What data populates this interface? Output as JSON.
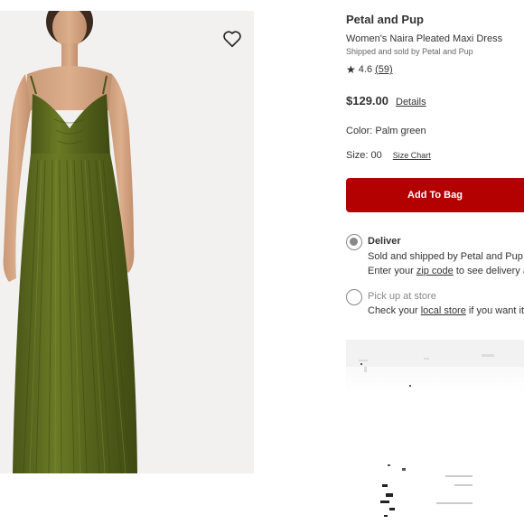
{
  "product": {
    "brand": "Petal and Pup",
    "name": "Women's Naira Pleated Maxi Dress",
    "shipped_by": "Shipped and sold by Petal and Pup",
    "rating": "4.6",
    "review_count": "(59)",
    "price": "$129.00",
    "price_details_link": "Details",
    "color": "Color: Palm green",
    "size": "Size: 00",
    "size_chart_link": "Size Chart",
    "add_to_bag_label": "Add To Bag"
  },
  "fulfillment": {
    "deliver": {
      "title": "Deliver",
      "line1": "Sold and shipped by Petal and Pup",
      "line2_prefix": "Enter your ",
      "line2_link": "zip code",
      "line2_suffix": " to see delivery av",
      "selected": true
    },
    "pickup": {
      "title": "Pick up at store",
      "line1_prefix": "Check your ",
      "line1_link": "local store",
      "line1_suffix": " if you want it s",
      "selected": false
    }
  },
  "icons": {
    "favorite": "heart-outline-icon",
    "rating_star": "star-icon"
  },
  "colors": {
    "add_to_bag_bg": "#b30000",
    "dress_green": "#5d6a1f",
    "photo_bg": "#f3f1ef"
  }
}
